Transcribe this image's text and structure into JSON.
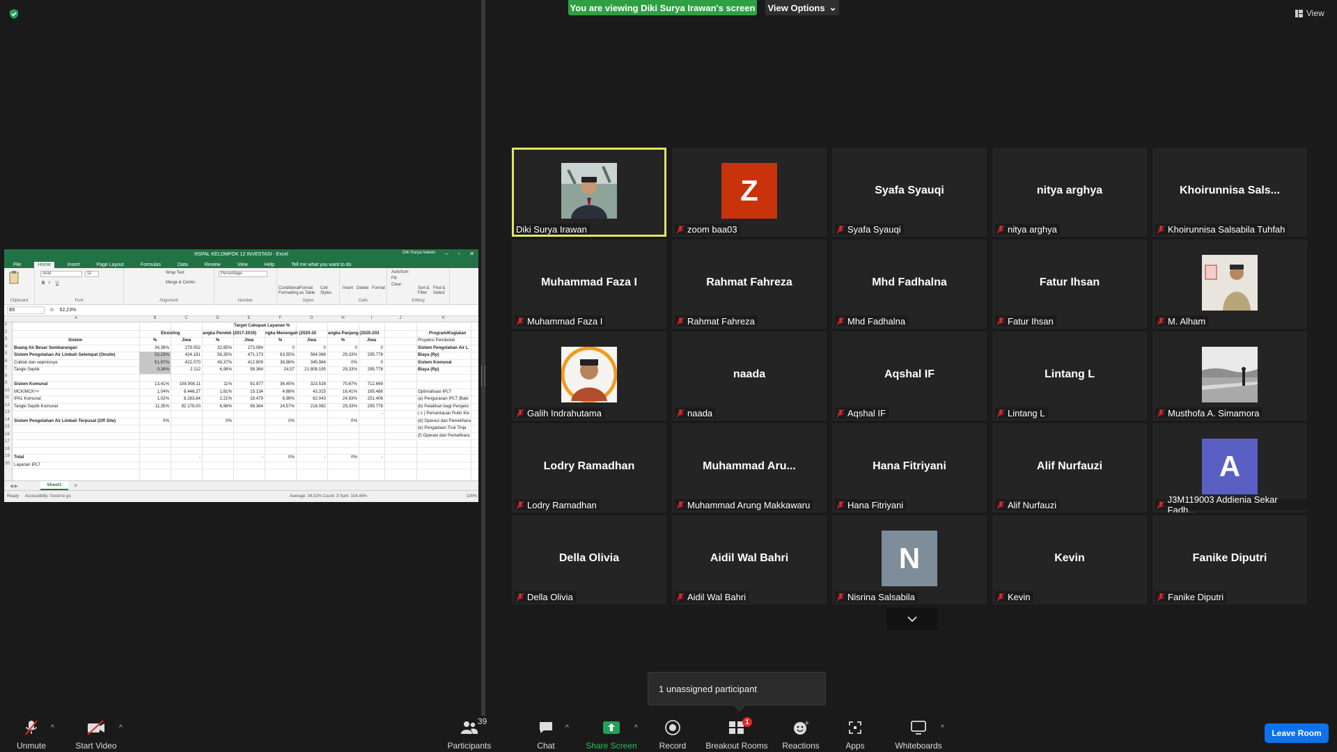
{
  "banner": {
    "viewing_text": "You are viewing Diki Surya Irawan's screen",
    "view_options_label": "View Options",
    "view_label": "View"
  },
  "excel": {
    "title": "RSPAL KELOMPOK 12 INVESTASI  -  Excel",
    "user": "Diki Surya Irawan",
    "tabs": [
      "File",
      "Home",
      "Insert",
      "Page Layout",
      "Formulas",
      "Data",
      "Review",
      "View",
      "Help"
    ],
    "tell_me": "Tell me what you want to do",
    "ribbon": {
      "font_name": "Arial",
      "font_size": "11",
      "number_format": "Percentage",
      "wrap_text": "Wrap Text",
      "merge_center": "Merge & Center",
      "autosum": "AutoSum",
      "fill": "Fill",
      "clear": "Clear",
      "conditional_formatting": "Conditional Formatting",
      "format_as_table": "Format as Table",
      "cell_styles": "Cell Styles",
      "insert": "Insert",
      "delete": "Delete",
      "format": "Format",
      "sort_filter": "Sort & Filter",
      "find_select": "Find & Select",
      "groups": [
        "Clipboard",
        "Font",
        "Alignment",
        "Number",
        "Styles",
        "Cells",
        "Editing"
      ]
    },
    "name_box": "B5",
    "formula_value": "52,23%",
    "columns": [
      "A",
      "B",
      "C",
      "D",
      "E",
      "F",
      "G",
      "H",
      "I",
      "J",
      "K"
    ],
    "rows": [
      "1",
      "2",
      "3",
      "4",
      "5",
      "6",
      "7",
      "8",
      "9",
      "10",
      "11",
      "12",
      "13",
      "14",
      "15",
      "16",
      "17",
      "18",
      "19",
      "20"
    ],
    "header_target": "Target Cakupan Layanan %",
    "header_sistem": "Sistem",
    "header_eksisting": "Eksisting",
    "header_pendek": "angka Pendek (2017-2019)",
    "header_menengah": "ngka Menengah (2020-20",
    "header_panjang": "angka Panjang (2025-203",
    "header_pct": "%",
    "header_jiwa": "Jiwa",
    "header_program": "Program/Kegiatan",
    "table": [
      [
        "Buang Air Besar Sembarangan",
        "34,36%",
        "279.052",
        "32,65%",
        "273.084",
        "0",
        "0",
        "0",
        "0"
      ],
      [
        "Sistem Pengolahan Air Limbah Setempat (Onsite)",
        "52,23%",
        "424.181",
        "56,35%",
        "471.173",
        "63,55%",
        "564.066",
        "29,33%",
        "295.778"
      ],
      [
        "Cubluk dan sejenisnya",
        "51,97%",
        "422.070",
        "49,37%",
        "412.809",
        "38,98%",
        "345.984",
        "0%",
        "0"
      ],
      [
        "Tangki Septik",
        "0,26%",
        "2.112",
        "6,98%",
        "58.364",
        "24,57",
        "21.808.195",
        "29,33%",
        "295.778"
      ],
      [
        "",
        "",
        "",
        "",
        "",
        "",
        "",
        "",
        ""
      ],
      [
        "Sistem Komunal",
        "13,41%",
        "108.908,11",
        "11%",
        "91.977",
        "36,45%",
        "323.528",
        "70,67%",
        "712.669"
      ],
      [
        "MCK/MCK++",
        "1,04%",
        "8.446,27",
        "1,81%",
        "15.134",
        "4,88%",
        "43.315",
        "16,41%",
        "165.486"
      ],
      [
        "IPAL Komunal",
        "1,02%",
        "8.283,84",
        "2,21%",
        "18.479",
        "6,99%",
        "62.043",
        "24,93%",
        "251.406"
      ],
      [
        "Tangki Septik Komunal",
        "11,35%",
        "92.178,00",
        "6,98%",
        "58.364",
        "24,57%",
        "218.082",
        "29,33%",
        "295.778"
      ],
      [
        "",
        "",
        "",
        "",
        "",
        "",
        "",
        "",
        "-"
      ],
      [
        "Sistem Pengolahan Air Limbah Terpusat (Off Site)",
        "0%",
        "",
        "0%",
        "",
        "0%",
        "",
        "0%",
        ""
      ],
      [
        "",
        "",
        "",
        "",
        "",
        "",
        "",
        "",
        ""
      ],
      [
        "",
        "",
        "",
        "",
        "",
        "",
        "",
        "",
        ""
      ],
      [
        "",
        "",
        "",
        "",
        "",
        "",
        "",
        "",
        ""
      ],
      [
        "",
        "",
        "",
        "",
        "",
        "",
        "",
        "",
        ""
      ],
      [
        "Total",
        "",
        "-",
        "",
        "-",
        "0%",
        "-",
        "0%",
        "-"
      ],
      [
        "Layanan IPLT",
        "",
        "",
        "",
        "",
        "",
        "",
        "",
        ""
      ]
    ],
    "program_items": [
      "Proyeksi Penduduk",
      "Sistem Pengolahan Air L",
      "Biaya (Rp)",
      "Sistem Komunal",
      "Biaya (Rp)",
      "",
      "",
      "Optimalisasi IPLT",
      "(a) Pengurasan IPLT (Baki",
      "(b) Pelatihan bagi Pengelo",
      "( c ) Pemantauan Rutin Kin",
      "(d) Operasi dan Pemelihara",
      "(e)  Pengadaan Truk Tinja",
      "(f)  Operasi dan Pemelihara"
    ],
    "sheet_tab": "Sheet1",
    "status_ready": "Ready",
    "status_accessibility": "Accessibility: Good to go",
    "status_stats": "Average: 34,02%    Count: 3    Sum: 104,46%",
    "status_zoom": "100%"
  },
  "participants": [
    {
      "display": "",
      "name": "Diki Surya Irawan",
      "type": "photo",
      "photo": "man-suit",
      "muted": false,
      "active": true
    },
    {
      "display": "Z",
      "name": "zoom baa03",
      "type": "avatar",
      "color": "#c8330c",
      "muted": true
    },
    {
      "display": "Syafa Syauqi",
      "name": "Syafa Syauqi",
      "type": "text",
      "muted": true
    },
    {
      "display": "nitya arghya",
      "name": "nitya arghya",
      "type": "text",
      "muted": true
    },
    {
      "display": "Khoirunnisa  Sals...",
      "name": "Khoirunnisa Salsabila Tuhfah",
      "type": "text",
      "muted": true
    },
    {
      "display": "Muhammad Faza I",
      "name": "Muhammad Faza I",
      "type": "text",
      "muted": true
    },
    {
      "display": "Rahmat Fahreza",
      "name": "Rahmat Fahreza",
      "type": "text",
      "muted": true
    },
    {
      "display": "Mhd Fadhalna",
      "name": "Mhd Fadhalna",
      "type": "text",
      "muted": true
    },
    {
      "display": "Fatur Ihsan",
      "name": "Fatur Ihsan",
      "type": "text",
      "muted": true
    },
    {
      "display": "",
      "name": "M. Alham",
      "type": "photo",
      "photo": "man-room",
      "muted": true
    },
    {
      "display": "",
      "name": "Galih Indrahutama",
      "type": "photo",
      "photo": "man-ring",
      "muted": true
    },
    {
      "display": "naada",
      "name": "naada",
      "type": "text",
      "muted": true
    },
    {
      "display": "Aqshal IF",
      "name": "Aqshal IF",
      "type": "text",
      "muted": true
    },
    {
      "display": "Lintang L",
      "name": "Lintang L",
      "type": "text",
      "muted": true
    },
    {
      "display": "",
      "name": "Musthofa A. Simamora",
      "type": "photo",
      "photo": "beach",
      "muted": true
    },
    {
      "display": "Lodry Ramadhan",
      "name": "Lodry Ramadhan",
      "type": "text",
      "muted": true
    },
    {
      "display": "Muhammad  Aru...",
      "name": "Muhammad Arung Makkawaru",
      "type": "text",
      "muted": true
    },
    {
      "display": "Hana Fitriyani",
      "name": "Hana Fitriyani",
      "type": "text",
      "muted": true
    },
    {
      "display": "Alif Nurfauzi",
      "name": "Alif Nurfauzi",
      "type": "text",
      "muted": true
    },
    {
      "display": "A",
      "name": "J3M119003 Addienia Sekar Fadh...",
      "type": "avatar",
      "color": "#5a5fc4",
      "muted": true
    },
    {
      "display": "Della Olivia",
      "name": "Della Olivia",
      "type": "text",
      "muted": true
    },
    {
      "display": "Aidil Wal Bahri",
      "name": "Aidil Wal Bahri",
      "type": "text",
      "muted": true
    },
    {
      "display": "N",
      "name": "Nisrina Salsabila",
      "type": "avatar",
      "color": "#7d8d99",
      "muted": true
    },
    {
      "display": "Kevin",
      "name": "Kevin",
      "type": "text",
      "muted": true
    },
    {
      "display": "Fanike Diputri",
      "name": "Fanike Diputri",
      "type": "text",
      "muted": true
    }
  ],
  "popover": {
    "text": "1 unassigned participant"
  },
  "toolbar": {
    "unmute": "Unmute",
    "start_video": "Start Video",
    "participants": "Participants",
    "participants_count": "39",
    "chat": "Chat",
    "share_screen": "Share Screen",
    "record": "Record",
    "breakout_rooms": "Breakout Rooms",
    "breakout_badge": "1",
    "reactions": "Reactions",
    "apps": "Apps",
    "whiteboards": "Whiteboards",
    "leave_room": "Leave Room"
  },
  "colors": {
    "accent_green": "#2ea043",
    "active_speaker": "#e3e65c",
    "leave_blue": "#0e72ed",
    "muted_red": "#e02828"
  }
}
